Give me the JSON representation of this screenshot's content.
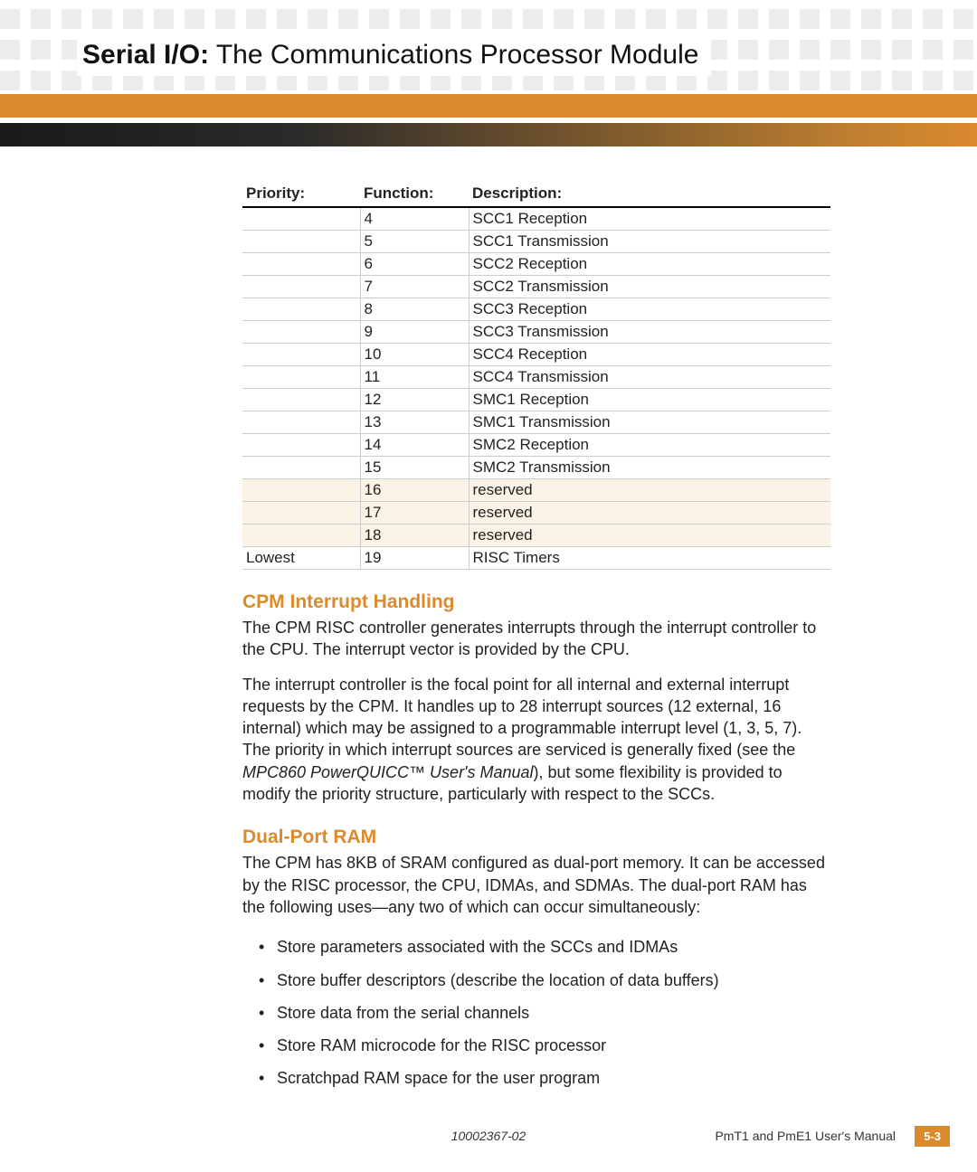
{
  "header": {
    "title_bold": "Serial I/O:",
    "title_rest": "The Communications Processor Module"
  },
  "table": {
    "headers": {
      "c1": "Priority:",
      "c2": "Function:",
      "c3": "Description:"
    },
    "rows": [
      {
        "priority": "",
        "func": "4",
        "desc": "SCC1 Reception",
        "reserved": false
      },
      {
        "priority": "",
        "func": "5",
        "desc": "SCC1 Transmission",
        "reserved": false
      },
      {
        "priority": "",
        "func": "6",
        "desc": "SCC2 Reception",
        "reserved": false
      },
      {
        "priority": "",
        "func": "7",
        "desc": "SCC2 Transmission",
        "reserved": false
      },
      {
        "priority": "",
        "func": "8",
        "desc": "SCC3 Reception",
        "reserved": false
      },
      {
        "priority": "",
        "func": "9",
        "desc": "SCC3 Transmission",
        "reserved": false
      },
      {
        "priority": "",
        "func": "10",
        "desc": "SCC4 Reception",
        "reserved": false
      },
      {
        "priority": "",
        "func": "11",
        "desc": "SCC4 Transmission",
        "reserved": false
      },
      {
        "priority": "",
        "func": "12",
        "desc": "SMC1 Reception",
        "reserved": false
      },
      {
        "priority": "",
        "func": "13",
        "desc": "SMC1 Transmission",
        "reserved": false
      },
      {
        "priority": "",
        "func": "14",
        "desc": "SMC2 Reception",
        "reserved": false
      },
      {
        "priority": "",
        "func": "15",
        "desc": "SMC2 Transmission",
        "reserved": false
      },
      {
        "priority": "",
        "func": "16",
        "desc": "reserved",
        "reserved": true
      },
      {
        "priority": "",
        "func": "17",
        "desc": "reserved",
        "reserved": true
      },
      {
        "priority": "",
        "func": "18",
        "desc": "reserved",
        "reserved": true
      },
      {
        "priority": "Lowest",
        "func": "19",
        "desc": "RISC Timers",
        "reserved": false
      }
    ]
  },
  "sections": {
    "s1": {
      "heading": "CPM Interrupt Handling",
      "p1": "The CPM RISC controller generates interrupts through the interrupt controller to the CPU. The interrupt vector is provided by the CPU.",
      "p2a": "The interrupt controller is the focal point for all internal and external interrupt requests by the CPM. It handles up to 28 interrupt sources (12 external, 16 internal) which may be assigned to a programmable interrupt level (1, 3, 5, 7). The priority in which interrupt sources are serviced is generally fixed (see the ",
      "p2_ital": "MPC860 PowerQUICC™ User's Manual",
      "p2b": "), but some flexibility is provided to modify the priority structure, particularly with respect to the SCCs."
    },
    "s2": {
      "heading": "Dual-Port RAM",
      "p1": "The CPM has 8KB of SRAM configured as dual-port memory. It can be accessed by the RISC processor, the CPU, IDMAs, and SDMAs. The dual-port RAM has the following uses—any two of which can occur simultaneously:",
      "bullets": [
        "Store parameters associated with the SCCs and IDMAs",
        "Store buffer descriptors (describe the location of data buffers)",
        "Store data from the serial channels",
        "Store RAM microcode for the RISC processor",
        "Scratchpad RAM space for the user program"
      ]
    }
  },
  "footer": {
    "doc_id": "10002367-02",
    "manual": "PmT1 and PmE1 User's Manual",
    "page": "5-3"
  }
}
